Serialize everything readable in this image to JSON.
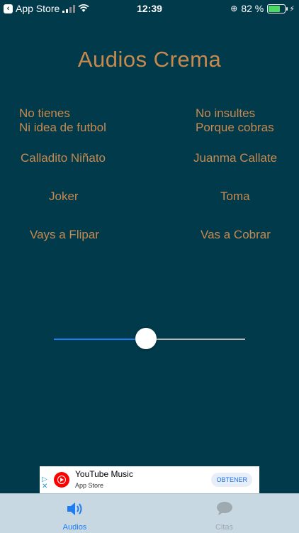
{
  "status_bar": {
    "back_label": "App Store",
    "time": "12:39",
    "battery_percent": "82 %",
    "battery_level": 0.82
  },
  "title": "Audios Crema",
  "audio_buttons": {
    "no_tienes": "No tienes\nNi idea de futbol",
    "no_insultes": "No insultes\nPorque cobras",
    "calladito": "Calladito Niñato",
    "juanma": "Juanma Callate",
    "joker": "Joker",
    "toma": "Toma",
    "vays_a_flipar": "Vays a Flipar",
    "vas_a_cobrar": "Vas a Cobrar"
  },
  "slider": {
    "value": 0.48
  },
  "ad": {
    "app_name": "YouTube Music",
    "store": "App Store",
    "cta": "OBTENER",
    "marker": "▷\n✕"
  },
  "tabs": [
    {
      "label": "Audios",
      "icon": "speaker-icon",
      "active": true,
      "color": "#1e7cf2"
    },
    {
      "label": "Citas",
      "icon": "chat-bubble-icon",
      "active": false,
      "color": "#9ea9b0"
    }
  ]
}
